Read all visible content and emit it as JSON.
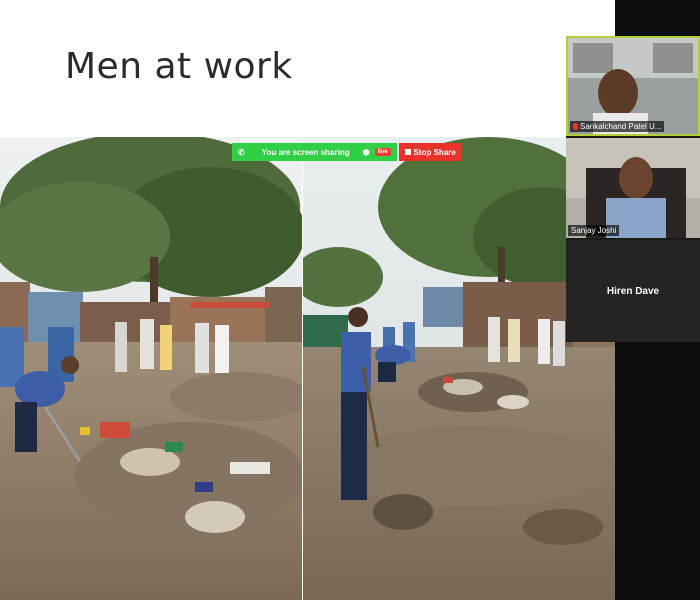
{
  "slide": {
    "title": "Men at work"
  },
  "share_bar": {
    "sharing_text": "You are screen sharing",
    "live_badge": "live",
    "stop_label": "Stop Share"
  },
  "participants": [
    {
      "name": "Sankalchand Patel U..."
    },
    {
      "name": "Sanjay Joshi"
    },
    {
      "name": "Hiren Dave"
    }
  ],
  "colors": {
    "share_green": "#2fcf46",
    "stop_red": "#e8322a",
    "active_speaker_border": "#b5cf3a",
    "panel_bg": "#0d0d0d"
  }
}
